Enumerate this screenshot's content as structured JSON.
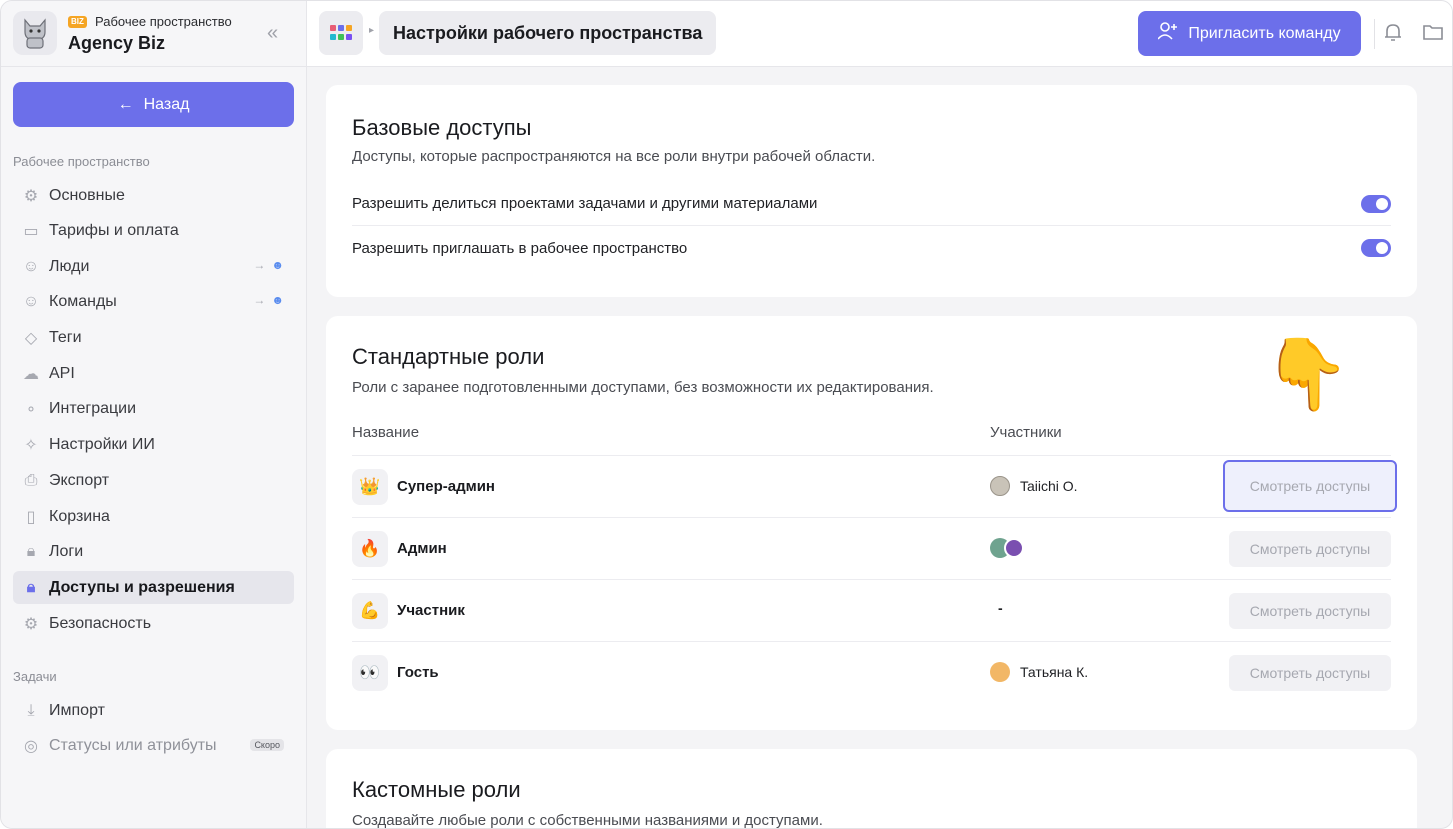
{
  "workspace": {
    "badge": "BIZ",
    "subtitle": "Рабочее пространство",
    "name": "Agency Biz",
    "collapse_icon": "double-chevron-left-icon"
  },
  "sidebar": {
    "back_label": "Назад",
    "section_workspace": "Рабочее пространство",
    "items": [
      {
        "label": "Основные",
        "icon": "gear-icon"
      },
      {
        "label": "Тарифы и оплата",
        "icon": "card-icon"
      },
      {
        "label": "Люди",
        "icon": "people-icon"
      },
      {
        "label": "Команды",
        "icon": "people-icon"
      },
      {
        "label": "Теги",
        "icon": "tag-icon"
      },
      {
        "label": "API",
        "icon": "cloud-icon"
      },
      {
        "label": "Интеграции",
        "icon": "integration-icon"
      },
      {
        "label": "Настройки ИИ",
        "icon": "sparkle-icon"
      },
      {
        "label": "Экспорт",
        "icon": "export-icon"
      },
      {
        "label": "Корзина",
        "icon": "trash-icon"
      },
      {
        "label": "Логи",
        "icon": "lock-icon"
      },
      {
        "label": "Доступы и разрешения",
        "icon": "lock-icon"
      },
      {
        "label": "Безопасность",
        "icon": "gear-icon"
      }
    ],
    "section_tasks": "Задачи",
    "task_items": [
      {
        "label": "Импорт",
        "icon": "download-icon"
      },
      {
        "label": "Статусы или атрибуты",
        "icon": "check-circle-icon",
        "badge": "Скоро"
      }
    ]
  },
  "topbar": {
    "breadcrumb": "Настройки рабочего пространства",
    "invite_label": "Пригласить команду"
  },
  "base_access": {
    "title": "Базовые доступы",
    "description": "Доступы, которые распространяются на все роли внутри рабочей области.",
    "permissions": [
      {
        "label": "Разрешить делиться проектами задачами и другими материалами",
        "enabled": true
      },
      {
        "label": "Разрешить приглашать в рабочее пространство",
        "enabled": true
      }
    ]
  },
  "standard_roles": {
    "title": "Стандартные роли",
    "description": "Роли с заранее подготовленными доступами, без возможности их редактирования.",
    "col_name": "Название",
    "col_members": "Участники",
    "view_label": "Смотреть доступы",
    "roles": [
      {
        "emoji": "👑",
        "name": "Супер-админ",
        "member": "Taiichi O."
      },
      {
        "emoji": "🔥",
        "name": "Админ",
        "member": ""
      },
      {
        "emoji": "💪",
        "name": "Участник",
        "member": "-"
      },
      {
        "emoji": "👀",
        "name": "Гость",
        "member": "Татьяна К."
      }
    ]
  },
  "custom_roles": {
    "title": "Кастомные роли",
    "description": "Создавайте любые роли с собственными названиями и доступами."
  },
  "colors": {
    "accent": "#6c6fea",
    "toggle_on": "#6c6fea"
  }
}
